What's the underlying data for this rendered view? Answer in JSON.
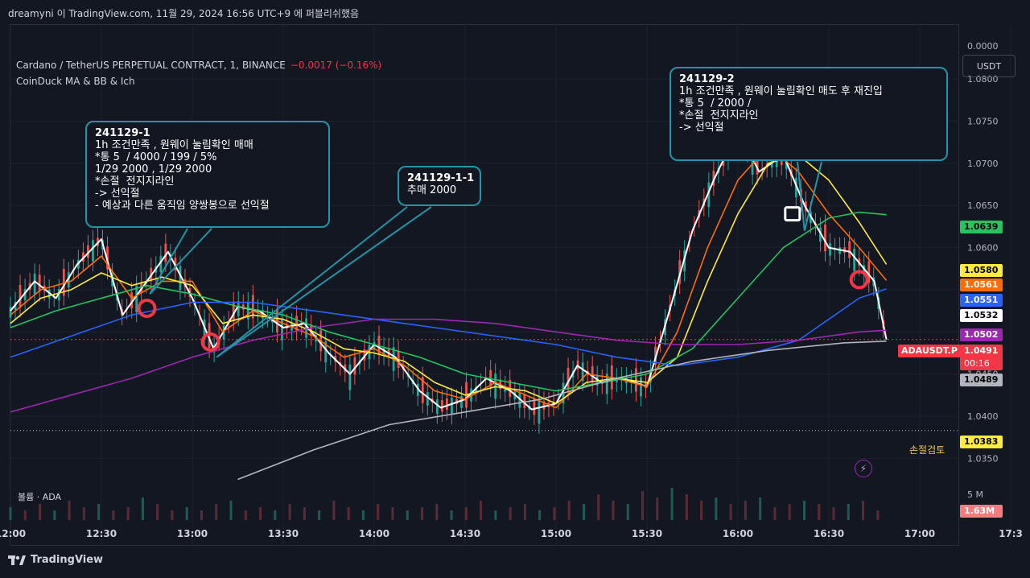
{
  "header": {
    "published": "dreamyni 이 TradingView.com, 11월 29, 2024 16:56 UTC+9 에 퍼블리쉬했음"
  },
  "symbol": {
    "title": "Cardano / TetherUS PERPETUAL CONTRACT, 1, BINANCE",
    "change": "−0.0017 (−0.16%)",
    "indicator": "CoinDuck MA & BB & Ich",
    "currency": "USDT",
    "ticker": "ADAUSDT.P",
    "last_price": "1.0491",
    "countdown": "00:16"
  },
  "price_labels": [
    {
      "text": "1.0639",
      "bg": "#22c55e",
      "fg": "#000000"
    },
    {
      "text": "1.0580",
      "bg": "#ffeb3b",
      "fg": "#000000"
    },
    {
      "text": "1.0561",
      "bg": "#ff6d00",
      "fg": "#ffffff"
    },
    {
      "text": "1.0551",
      "bg": "#2962ff",
      "fg": "#ffffff"
    },
    {
      "text": "1.0532",
      "bg": "#ffffff",
      "fg": "#000000"
    },
    {
      "text": "1.0502",
      "bg": "#9c27b0",
      "fg": "#ffffff"
    },
    {
      "text": "1.0489",
      "bg": "#b2b5be",
      "fg": "#000000"
    },
    {
      "text": "1.0383",
      "bg": "#ffeb3b",
      "fg": "#000000"
    },
    {
      "text": "1.63M",
      "bg": "#f77c80",
      "fg": "#ffffff"
    }
  ],
  "stop_label": "손절검토",
  "volume_label": "볼륨 · ADA",
  "volume_scale": "5 M",
  "notes": [
    {
      "lines": [
        "241129-1",
        "1h 조건만족 , 원웨이 눌림확인 매매",
        "*통 5  / 4000 / 199 / 5%",
        "1/29 2000 , 1/29 2000",
        "*손절  전지지라인",
        "-> 선익절",
        "- 예상과 다른 움직임 양쌍봉으로 선익절"
      ]
    },
    {
      "lines": [
        "241129-1-1",
        "추매 2000"
      ]
    },
    {
      "lines": [
        "241129-2",
        "1h 조건만족 , 원웨이 눌림확인 매도 후 재진입",
        "*통 5  / 2000 /",
        "*손절  전지지라인",
        "-> 선익절"
      ]
    }
  ],
  "brand": "TradingView",
  "chart_data": {
    "type": "line",
    "title": "Cardano / TetherUS PERPETUAL CONTRACT, 1, BINANCE",
    "x_ticks": [
      "12:00",
      "12:30",
      "13:00",
      "13:30",
      "14:00",
      "14:30",
      "15:00",
      "15:30",
      "16:00",
      "16:30",
      "17:00",
      "17:3"
    ],
    "y_ticks": [
      "0.0000",
      "1.0800",
      "1.0750",
      "1.0700",
      "1.0650",
      "1.0600",
      "1.0450",
      "1.0400",
      "1.0350"
    ],
    "ylim": [
      1.0315,
      1.0845
    ],
    "x_minutes": [
      0,
      300
    ],
    "series": [
      {
        "color": "#ffffff",
        "x": [
          0,
          8,
          15,
          22,
          30,
          37,
          45,
          52,
          60,
          67,
          75,
          82,
          90,
          97,
          105,
          112,
          120,
          127,
          135,
          142,
          150,
          157,
          165,
          172,
          180,
          187,
          195,
          202,
          210,
          217,
          225,
          232,
          240,
          247,
          255,
          262,
          270,
          277,
          285,
          289
        ],
        "values": [
          1.0525,
          1.056,
          1.054,
          1.058,
          1.061,
          1.052,
          1.056,
          1.0595,
          1.054,
          1.048,
          1.053,
          1.0525,
          1.0505,
          1.051,
          1.0475,
          1.045,
          1.0485,
          1.047,
          1.043,
          1.041,
          1.042,
          1.0445,
          1.043,
          1.0408,
          1.0415,
          1.046,
          1.044,
          1.0445,
          1.0435,
          1.052,
          1.062,
          1.068,
          1.074,
          1.069,
          1.071,
          1.065,
          1.06,
          1.0595,
          1.056,
          1.0491
        ]
      },
      {
        "color": "#ff6d00",
        "x": [
          0,
          10,
          20,
          30,
          40,
          50,
          60,
          70,
          80,
          90,
          100,
          110,
          120,
          130,
          140,
          150,
          160,
          170,
          180,
          190,
          200,
          210,
          220,
          230,
          240,
          250,
          260,
          270,
          280,
          289
        ],
        "values": [
          1.052,
          1.055,
          1.056,
          1.059,
          1.054,
          1.056,
          1.056,
          1.05,
          1.0525,
          1.051,
          1.0495,
          1.047,
          1.048,
          1.046,
          1.043,
          1.042,
          1.044,
          1.0425,
          1.041,
          1.045,
          1.0445,
          1.0435,
          1.05,
          1.06,
          1.068,
          1.072,
          1.069,
          1.064,
          1.06,
          1.0561
        ]
      },
      {
        "color": "#ffeb3b",
        "x": [
          0,
          10,
          20,
          30,
          40,
          50,
          60,
          70,
          80,
          90,
          100,
          110,
          120,
          130,
          140,
          150,
          160,
          170,
          180,
          190,
          200,
          210,
          220,
          230,
          240,
          250,
          260,
          270,
          280,
          289
        ],
        "values": [
          1.051,
          1.054,
          1.055,
          1.057,
          1.0555,
          1.0565,
          1.0555,
          1.051,
          1.052,
          1.0515,
          1.05,
          1.048,
          1.0475,
          1.0465,
          1.044,
          1.0425,
          1.0435,
          1.043,
          1.0415,
          1.044,
          1.0445,
          1.044,
          1.047,
          1.056,
          1.064,
          1.07,
          1.071,
          1.068,
          1.063,
          1.058
        ]
      },
      {
        "color": "#22c55e",
        "x": [
          0,
          15,
          30,
          45,
          60,
          75,
          90,
          105,
          120,
          135,
          150,
          165,
          180,
          195,
          210,
          225,
          240,
          255,
          270,
          280,
          289
        ],
        "values": [
          1.0505,
          1.0525,
          1.054,
          1.0555,
          1.0545,
          1.053,
          1.052,
          1.05,
          1.0485,
          1.047,
          1.045,
          1.044,
          1.043,
          1.044,
          1.045,
          1.048,
          1.054,
          1.06,
          1.0635,
          1.0642,
          1.0639
        ]
      },
      {
        "color": "#2962ff",
        "x": [
          0,
          20,
          40,
          60,
          80,
          100,
          120,
          140,
          160,
          180,
          200,
          220,
          240,
          260,
          280,
          289
        ],
        "values": [
          1.047,
          1.0495,
          1.052,
          1.0535,
          1.0535,
          1.0525,
          1.0515,
          1.0505,
          1.0495,
          1.0485,
          1.047,
          1.046,
          1.047,
          1.049,
          1.054,
          1.0551
        ]
      },
      {
        "color": "#9c27b0",
        "x": [
          0,
          20,
          40,
          60,
          80,
          100,
          120,
          140,
          160,
          180,
          200,
          220,
          240,
          260,
          280,
          289
        ],
        "values": [
          1.0405,
          1.0425,
          1.0445,
          1.047,
          1.049,
          1.0505,
          1.0515,
          1.0515,
          1.051,
          1.05,
          1.049,
          1.0485,
          1.0485,
          1.049,
          1.05,
          1.0502
        ]
      },
      {
        "color": "#b2b5be",
        "x": [
          75,
          100,
          125,
          150,
          175,
          200,
          225,
          250,
          275,
          289
        ],
        "values": [
          1.0325,
          1.036,
          1.039,
          1.0405,
          1.042,
          1.0445,
          1.0465,
          1.0478,
          1.0487,
          1.0489
        ]
      }
    ],
    "stop_line": 1.0383,
    "last_line": 1.0491,
    "volume": [
      0.4,
      0.3,
      0.5,
      0.3,
      0.6,
      0.4,
      0.5,
      0.3,
      0.4,
      0.7,
      0.5,
      0.3,
      0.4,
      0.3,
      0.5,
      0.6,
      0.3,
      0.4,
      0.3,
      0.5,
      0.4,
      0.3,
      0.6,
      0.4,
      0.3,
      0.5,
      0.4,
      0.3,
      0.4,
      0.5,
      0.3,
      0.4,
      0.6,
      0.3,
      0.4,
      0.5,
      0.3,
      0.4,
      0.6,
      0.5,
      0.8,
      0.6,
      0.5,
      0.9,
      0.7,
      1.0,
      0.8,
      0.6,
      0.7,
      0.5,
      0.6,
      0.7,
      0.4,
      0.5,
      0.6,
      0.5,
      0.4,
      0.5,
      0.6,
      0.3
    ],
    "volume_max_label": 5
  }
}
